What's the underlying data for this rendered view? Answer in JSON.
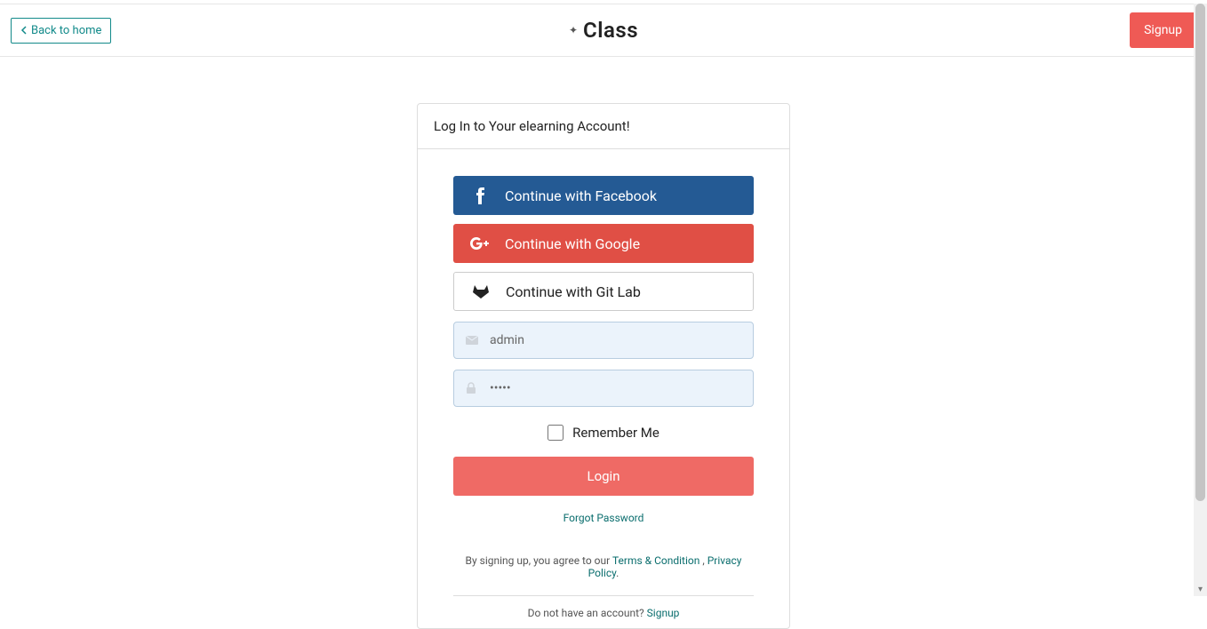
{
  "header": {
    "back_label": "Back to home",
    "brand": "Class",
    "signup_label": "Signup"
  },
  "card": {
    "title": "Log In to Your elearning Account!",
    "social": {
      "facebook": "Continue with Facebook",
      "google": "Continue with Google",
      "gitlab": "Continue with Git Lab"
    },
    "inputs": {
      "username_value": "admin",
      "password_value": "•••••"
    },
    "remember_label": "Remember Me",
    "login_label": "Login",
    "forgot_label": "Forgot Password",
    "terms_prefix": "By signing up, you agree to our ",
    "terms_link": "Terms & Condition",
    "terms_sep": " , ",
    "privacy_link": "Privacy Policy",
    "bottom_text": "Do not have an account? ",
    "bottom_link": "Signup"
  }
}
